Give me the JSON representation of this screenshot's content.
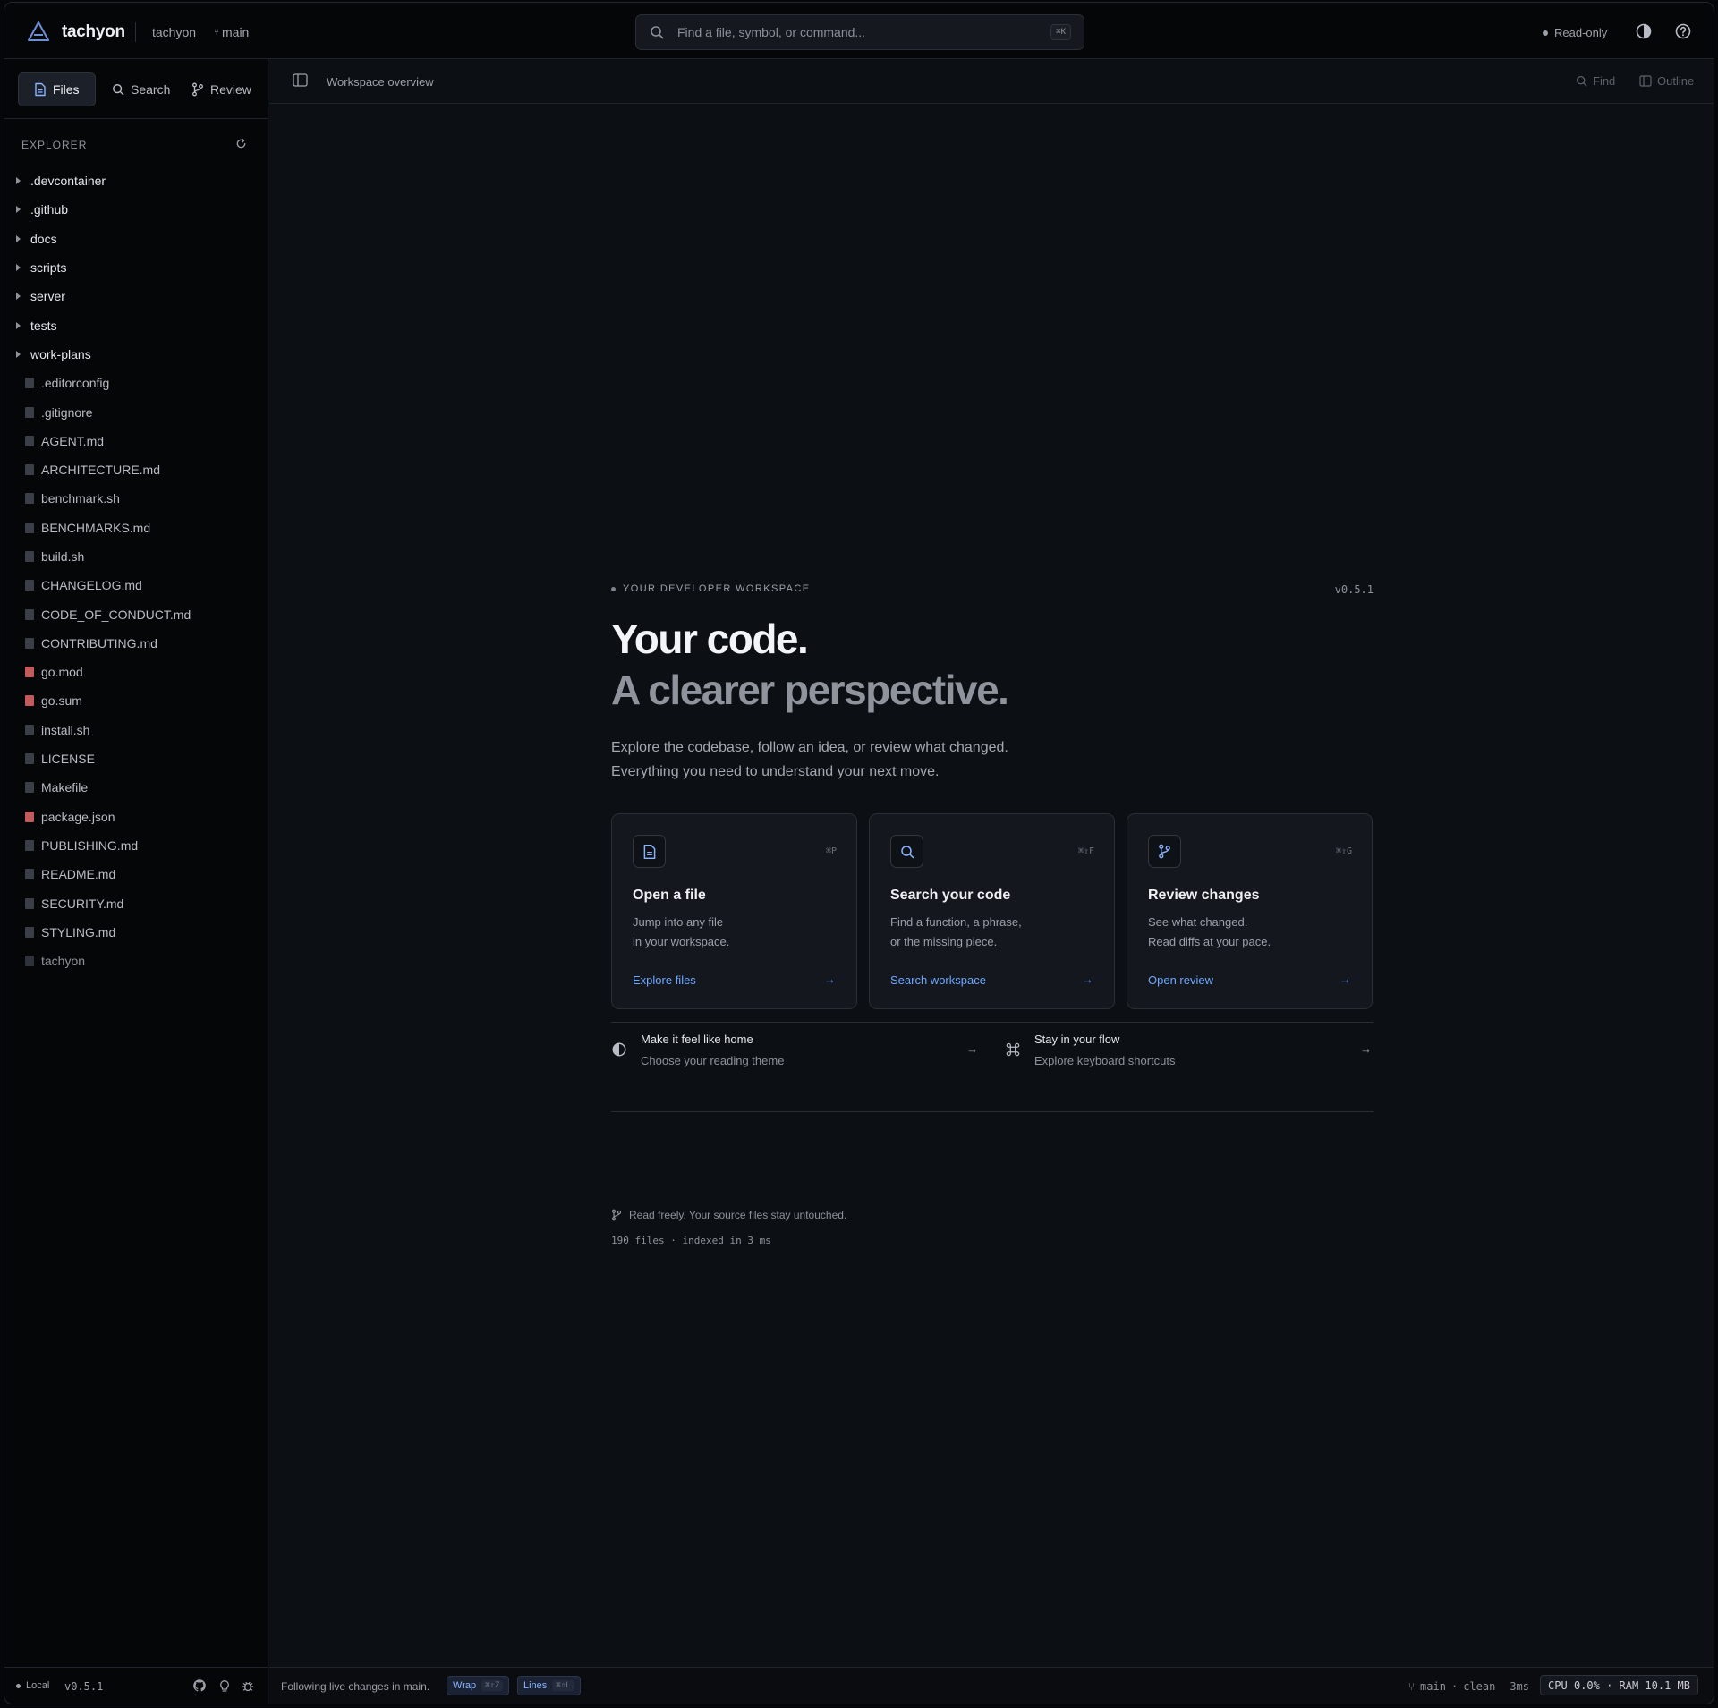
{
  "topbar": {
    "brand": "tachyon",
    "project": "tachyon",
    "branch": "main",
    "search_placeholder": "Find a file, symbol, or command...",
    "search_shortcut": "⌘K",
    "readonly": "Read-only"
  },
  "sidebar": {
    "tabs": [
      {
        "label": "Files",
        "icon": "file-icon",
        "active": true
      },
      {
        "label": "Search",
        "icon": "search-icon",
        "active": false
      },
      {
        "label": "Review",
        "icon": "git-branch-icon",
        "active": false
      }
    ],
    "explorer_title": "EXPLORER",
    "folders": [
      ".devcontainer",
      ".github",
      "docs",
      "scripts",
      "server",
      "tests",
      "work-plans"
    ],
    "files": [
      ".editorconfig",
      ".gitignore",
      "AGENT.md",
      "ARCHITECTURE.md",
      "benchmark.sh",
      "BENCHMARKS.md",
      "build.sh",
      "CHANGELOG.md",
      "CODE_OF_CONDUCT.md",
      "CONTRIBUTING.md",
      "go.mod",
      "go.sum",
      "install.sh",
      "LICENSE",
      "Makefile",
      "package.json",
      "PUBLISHING.md",
      "README.md",
      "SECURITY.md",
      "STYLING.md",
      "tachyon"
    ],
    "footer": {
      "mode": "Local",
      "version": "v0.5.1"
    }
  },
  "main": {
    "breadcrumb": "Workspace overview",
    "find_label": "Find",
    "outline_label": "Outline",
    "eyebrow": "YOUR DEVELOPER WORKSPACE",
    "version": "v0.5.1",
    "headline_1": "Your code.",
    "headline_2": "A clearer perspective.",
    "lead_1": "Explore the codebase, follow an idea, or review what changed.",
    "lead_2": "Everything you need to understand your next move.",
    "cards": [
      {
        "title": "Open a file",
        "shortcut": "⌘P",
        "desc_1": "Jump into any file",
        "desc_2": "in your workspace.",
        "link": "Explore files",
        "arrow": "→",
        "icon": "file-icon"
      },
      {
        "title": "Search your code",
        "shortcut": "⌘⇧F",
        "desc_1": "Find a function, a phrase,",
        "desc_2": "or the missing piece.",
        "link": "Search workspace",
        "arrow": "→",
        "icon": "search-icon"
      },
      {
        "title": "Review changes",
        "shortcut": "⌘⇧G",
        "desc_1": "See what changed.",
        "desc_2": "Read diffs at your pace.",
        "link": "Open review",
        "arrow": "→",
        "icon": "git-branch-icon"
      }
    ],
    "prefs": [
      {
        "title": "Make it feel like home",
        "subtitle": "Choose your reading theme",
        "arrow": "→",
        "icon": "contrast-icon"
      },
      {
        "title": "Stay in your flow",
        "subtitle": "Explore keyboard shortcuts",
        "arrow": "→",
        "icon": "command-icon"
      }
    ],
    "note": "Read freely. Your source files stay untouched.",
    "stats": "190 files · indexed in 3 ms"
  },
  "statusbar": {
    "follow": "Following live changes in main.",
    "wrap_label": "Wrap",
    "wrap_shortcut": "⌘⇧Z",
    "lines_label": "Lines",
    "lines_shortcut": "⌘⇧L",
    "branch": "main",
    "git_state": "clean",
    "latency": "3ms",
    "perf": "CPU 0.0% · RAM 10.1 MB"
  },
  "colors": {
    "accent": "#6ea8ff",
    "background": "#0c0f14",
    "sidebar": "#050608"
  }
}
